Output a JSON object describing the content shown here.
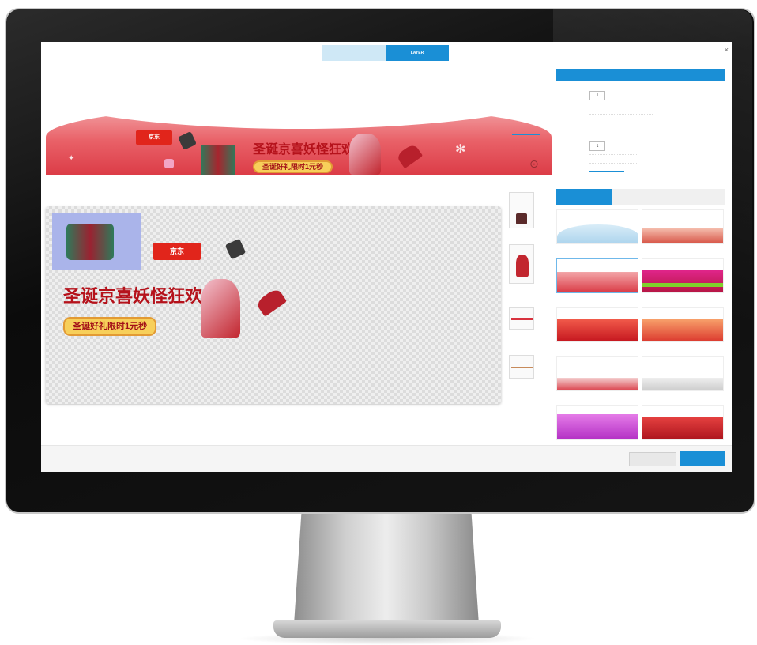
{
  "app": {
    "tabs": [
      {
        "label": "",
        "active": false
      },
      {
        "label": "LAYER",
        "active": true
      }
    ]
  },
  "banner": {
    "section_label": "",
    "logo_text": "京东",
    "headline": "圣诞京喜妖怪狂欢",
    "pill_text": "圣诞好礼限时1元秒",
    "legend_text": ""
  },
  "workspace": {
    "section_label": "",
    "logo_text": "京东",
    "headline": "圣诞京喜妖怪狂欢",
    "pill_text": "圣诞好礼限时1元秒"
  },
  "layers": {
    "items": [
      "",
      "",
      "",
      ""
    ]
  },
  "panel": {
    "title": "",
    "fields": [
      {
        "label": "",
        "value": "1"
      },
      {
        "label": "",
        "value": "1"
      }
    ],
    "link_text": "",
    "template_tabs": [
      {
        "label": "",
        "active": true
      },
      {
        "label": "",
        "active": false
      },
      {
        "label": "",
        "active": false
      }
    ],
    "templates": [
      {
        "caption": "",
        "selected": false
      },
      {
        "caption": "",
        "selected": false
      },
      {
        "caption": "",
        "selected": true
      },
      {
        "caption": "",
        "selected": false
      },
      {
        "caption": "",
        "selected": false
      },
      {
        "caption": "",
        "selected": false
      },
      {
        "caption": "",
        "selected": false
      },
      {
        "caption": "",
        "selected": false
      },
      {
        "caption": "",
        "selected": false
      },
      {
        "caption": "",
        "selected": false
      }
    ]
  },
  "footer": {
    "secondary_label": "",
    "primary_label": ""
  },
  "colors": {
    "accent": "#1a8fd6",
    "brand_red": "#e1251b",
    "banner_red": "#d8323e",
    "pill_gold": "#f7cf5a"
  }
}
